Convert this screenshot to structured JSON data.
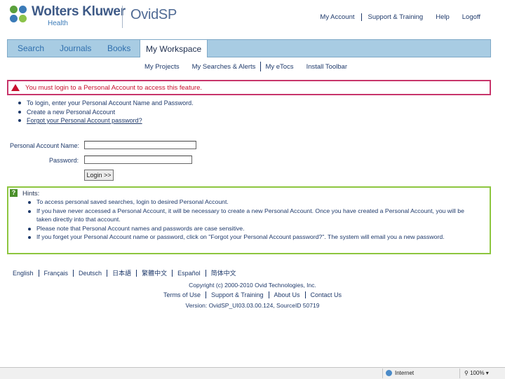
{
  "header": {
    "brand": "Wolters Kluwer",
    "brand_sub": "Health",
    "product": "OvidSP",
    "top_links": [
      "My Account",
      "Support & Training",
      "Help",
      "Logoff"
    ]
  },
  "tabs": [
    {
      "label": "Search",
      "active": false
    },
    {
      "label": "Journals",
      "active": false
    },
    {
      "label": "Books",
      "active": false
    },
    {
      "label": "My Workspace",
      "active": true
    }
  ],
  "subnav": [
    "My Projects",
    "My Searches & Alerts",
    "My eTocs",
    "Install Toolbar"
  ],
  "error": {
    "message": "You must login to a Personal Account to access this feature."
  },
  "login_help": [
    "To login, enter your Personal Account Name and Password.",
    "Create a new Personal Account",
    "Forgot your Personal Account password?"
  ],
  "form": {
    "name_label": "Personal Account Name:",
    "name_value": "",
    "password_label": "Password:",
    "password_value": "",
    "login_button": "Login >>"
  },
  "hints": {
    "title": "Hints:",
    "items": [
      "To access personal saved searches, login to desired Personal Account.",
      "If you have never accessed a Personal Account, it will be necessary to create a new Personal Account. Once you have created a Personal Account, you will be taken directly into that account.",
      "Please note that Personal Account names and passwords are case sensitive.",
      "If you forget your Personal Account name or password, click on \"Forgot your Personal Account password?\". The system will email you a new password."
    ]
  },
  "footer": {
    "languages": [
      "English",
      "Français",
      "Deutsch",
      "日本語",
      "繁體中文",
      "Español",
      "简体中文"
    ],
    "copyright": "Copyright (c) 2000-2010 Ovid Technologies, Inc.",
    "links": [
      "Terms of Use",
      "Support & Training",
      "About Us",
      "Contact Us"
    ],
    "version": "Version: OvidSP_UI03.03.00.124, SourceID 50719"
  },
  "statusbar": {
    "zone": "Internet",
    "zoom": "100%"
  },
  "colors": {
    "error_border": "#c8356b",
    "hint_border": "#8dc63f",
    "tabbar": "#a8cce3",
    "link": "#1f3a6b"
  }
}
